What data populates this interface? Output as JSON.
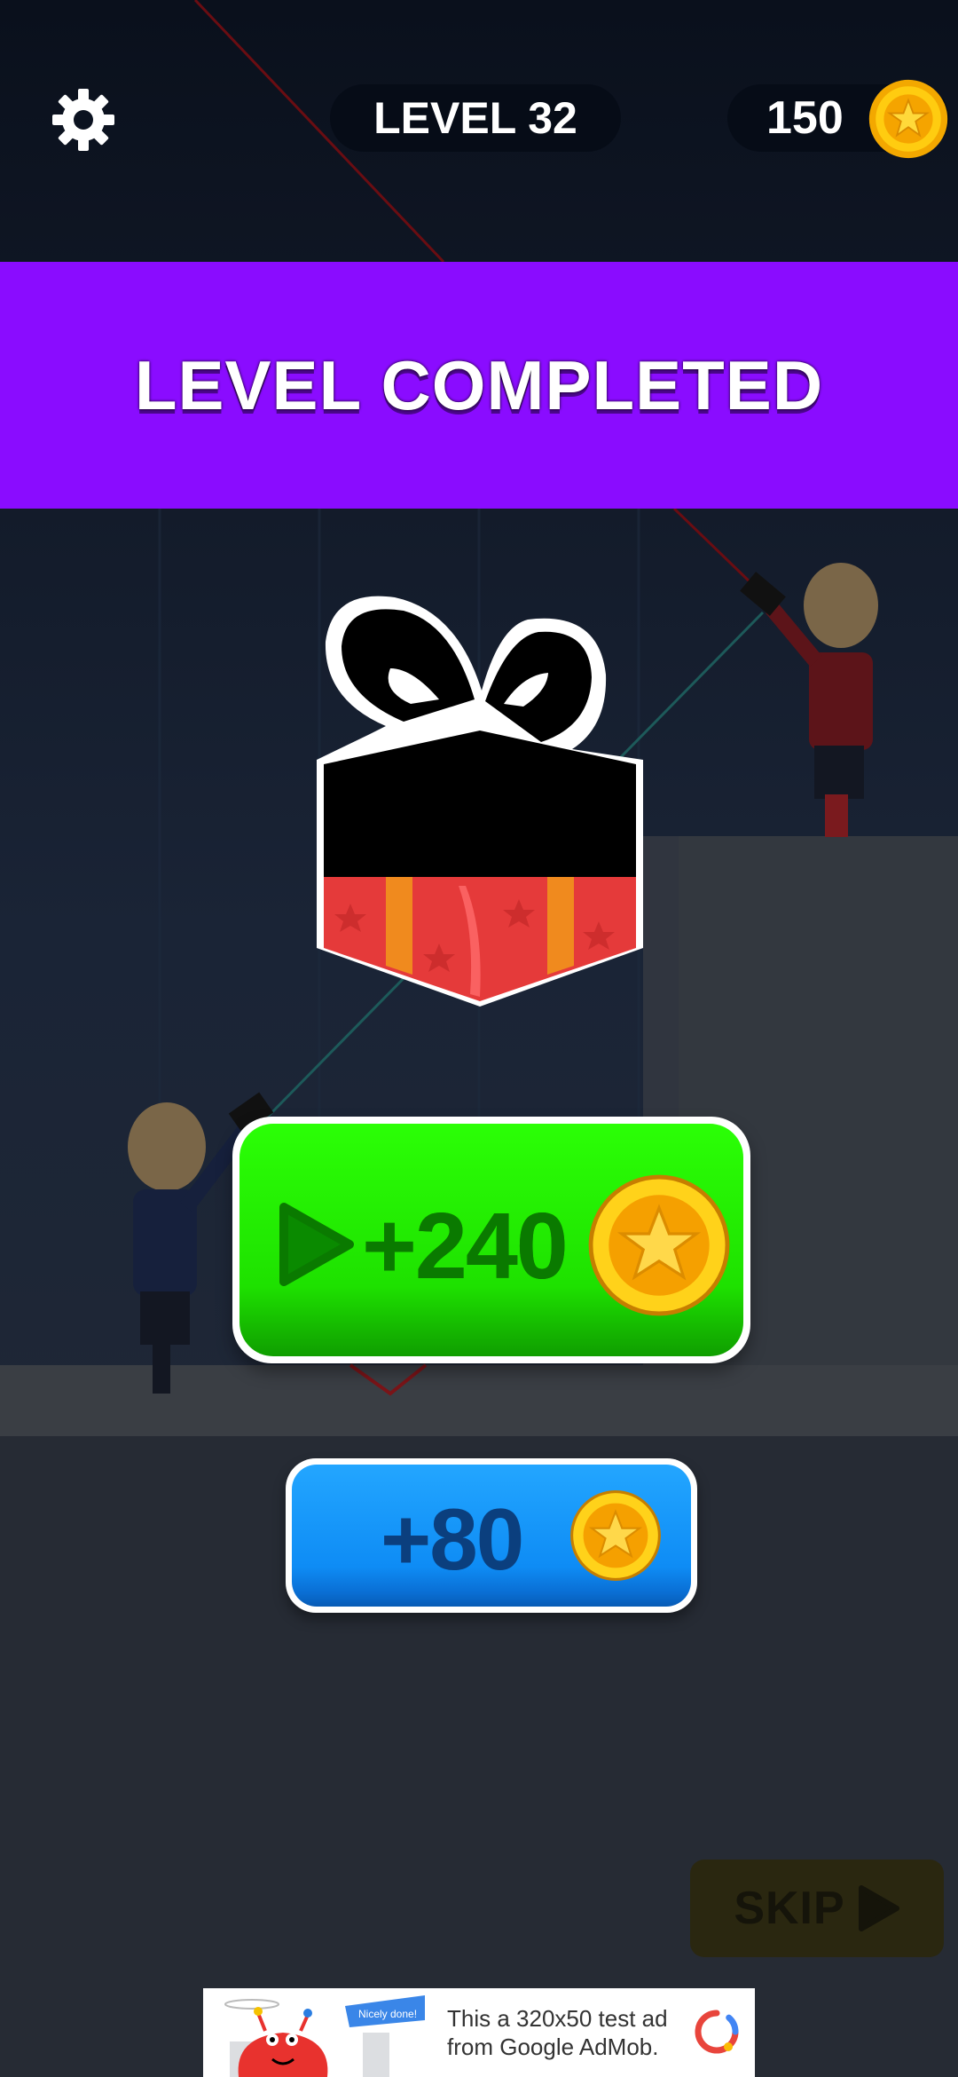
{
  "hud": {
    "level_label": "LEVEL 32",
    "coin_balance": "150"
  },
  "banner": {
    "title": "LEVEL COMPLETED",
    "color": "#8a0cff"
  },
  "rewards": {
    "video_reward_label": "+240",
    "basic_reward_label": "+80"
  },
  "skip": {
    "label": "SKIP"
  },
  "ad": {
    "text": "This a 320x50 test ad from Google AdMob.",
    "badge": "Nicely done!"
  },
  "icons": {
    "settings": "gear-icon",
    "coin": "star-coin-icon",
    "gift": "gift-box-icon",
    "play": "play-icon"
  },
  "colors": {
    "green_button": "#1ee100",
    "blue_button": "#0e8cf5",
    "coin": "#f6b800"
  }
}
